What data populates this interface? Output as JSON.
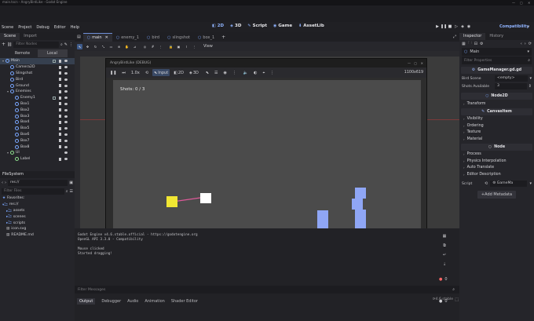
{
  "window": {
    "title": "main.tscn - AngryBirdLike - Godot Engine"
  },
  "menu": {
    "items": [
      "Scene",
      "Project",
      "Debug",
      "Editor",
      "Help"
    ]
  },
  "workspaces": [
    {
      "label": "2D",
      "active": true
    },
    {
      "label": "3D",
      "active": false
    },
    {
      "label": "Script",
      "active": false
    },
    {
      "label": "Game",
      "active": false
    },
    {
      "label": "AssetLib",
      "active": false
    }
  ],
  "renderer": "Compatibility",
  "left_dock": {
    "tabs": [
      "Scene",
      "Import"
    ],
    "filter_placeholder": "Filter Nodes",
    "remote_label": "Remote",
    "local_label": "Local",
    "tree": [
      {
        "name": "Main",
        "indent": 0,
        "color": "#7aa7ff",
        "selected": true
      },
      {
        "name": "Camera2D",
        "indent": 1,
        "color": "#7aa7ff"
      },
      {
        "name": "Slingshot",
        "indent": 1,
        "color": "#7aa7ff"
      },
      {
        "name": "Bird",
        "indent": 1,
        "color": "#7aa7ff"
      },
      {
        "name": "Ground",
        "indent": 1,
        "color": "#7aa7ff"
      },
      {
        "name": "Enemies",
        "indent": 1,
        "color": "#7aa7ff"
      },
      {
        "name": "Enemy1",
        "indent": 2,
        "color": "#7aa7ff"
      },
      {
        "name": "Box1",
        "indent": 2,
        "color": "#7aa7ff"
      },
      {
        "name": "Box2",
        "indent": 2,
        "color": "#7aa7ff"
      },
      {
        "name": "Box3",
        "indent": 2,
        "color": "#7aa7ff"
      },
      {
        "name": "Box4",
        "indent": 2,
        "color": "#7aa7ff"
      },
      {
        "name": "Box5",
        "indent": 2,
        "color": "#7aa7ff"
      },
      {
        "name": "Box6",
        "indent": 2,
        "color": "#7aa7ff"
      },
      {
        "name": "Box7",
        "indent": 2,
        "color": "#7aa7ff"
      },
      {
        "name": "Box8",
        "indent": 2,
        "color": "#7aa7ff"
      },
      {
        "name": "UI",
        "indent": 1,
        "color": "#8fe08f"
      },
      {
        "name": "Label",
        "indent": 2,
        "color": "#8fe08f"
      }
    ],
    "filesystem_title": "FileSystem",
    "path": "res://",
    "filter_files_placeholder": "Filter Files",
    "files": [
      {
        "name": "Favorites:",
        "indent": 0,
        "kind": "fav"
      },
      {
        "name": "res://",
        "indent": 0,
        "kind": "root"
      },
      {
        "name": "assets",
        "indent": 1,
        "kind": "folder"
      },
      {
        "name": "scenes",
        "indent": 1,
        "kind": "folder"
      },
      {
        "name": "scripts",
        "indent": 1,
        "kind": "folder"
      },
      {
        "name": "icon.svg",
        "indent": 1,
        "kind": "file"
      },
      {
        "name": "README.md",
        "indent": 1,
        "kind": "file"
      }
    ]
  },
  "scene_tabs": [
    {
      "label": "main",
      "active": true
    },
    {
      "label": "enemy_1",
      "active": false
    },
    {
      "label": "bird",
      "active": false
    },
    {
      "label": "slingshot",
      "active": false
    },
    {
      "label": "box_1",
      "active": false
    }
  ],
  "viewport": {
    "view_label": "View"
  },
  "game_window": {
    "title": "AngryBirdLike (DEBUG)",
    "speed": "1.0x",
    "input_label": "Input",
    "mode_2d": "2D",
    "mode_3d": "3D",
    "resolution": "1100x619",
    "shots_text": "Shots: 0 / 3",
    "colors": {
      "background": "#4b4b4b",
      "ground": "#a86f6f",
      "bird": "#f1e633",
      "slingshot": "#ffffff",
      "band": "#e05a9a",
      "box": "#8fa6f5",
      "enemy": "#f25fe8"
    }
  },
  "output": {
    "lines": [
      "Godot Engine v4.6.stable.official - https://godotengine.org",
      "OpenGL API 3.3.0 - Compatibility",
      "",
      "Mouse clicked",
      "Started dragging!"
    ],
    "filter_placeholder": "Filter Messages",
    "counts": {
      "errors": "0",
      "warnings": "0",
      "messages": "0"
    },
    "tabs": [
      "Output",
      "Debugger",
      "Audio",
      "Animation",
      "Shader Editor"
    ],
    "version": "4.6.stable"
  },
  "inspector": {
    "tabs": [
      "Inspector",
      "History"
    ],
    "node_name": "Main",
    "filter_placeholder": "Filter Properties",
    "script_file": "GameManager.gd.gd",
    "props": [
      {
        "name": "Bird Scene",
        "value": "<empty>"
      },
      {
        "name": "Shots Available",
        "value": "3"
      }
    ],
    "categories": {
      "node2d": "Node2D",
      "canvasitem": "CanvasItem",
      "node": "Node"
    },
    "node2d_sections": [
      "Transform"
    ],
    "canvasitem_sections": [
      "Visibility",
      "Ordering",
      "Texture",
      "Material"
    ],
    "node_sections": [
      "Process",
      "Physics Interpolation",
      "Auto Translate",
      "Editor Description"
    ],
    "script_label": "Script",
    "script_value": "GameMa",
    "add_metadata": "Add Metadata"
  }
}
